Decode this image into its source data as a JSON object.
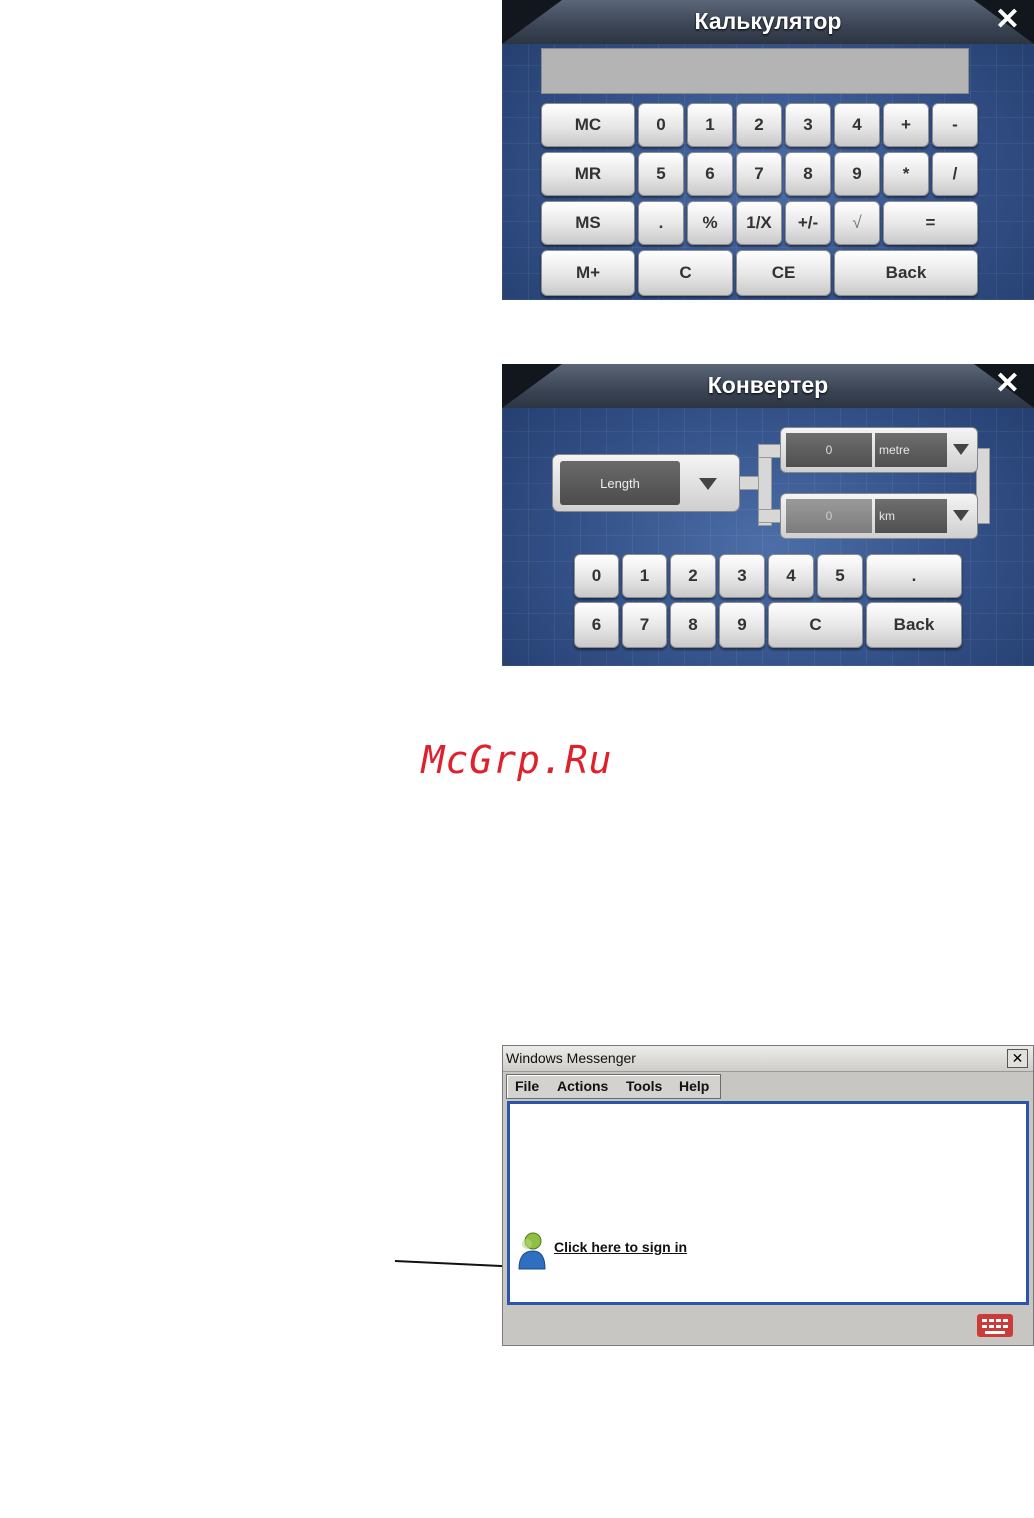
{
  "calculator": {
    "title": "Калькулятор",
    "close_glyph": "✕",
    "display_value": "",
    "keys": {
      "mc": "MC",
      "mr": "MR",
      "ms": "MS",
      "mplus": "M+",
      "d0": "0",
      "d1": "1",
      "d2": "2",
      "d3": "3",
      "d4": "4",
      "d5": "5",
      "d6": "6",
      "d7": "7",
      "d8": "8",
      "d9": "9",
      "plus": "+",
      "minus": "-",
      "multiply": "*",
      "divide": "/",
      "dot": ".",
      "percent": "%",
      "reciprocal": "1/X",
      "sign": "+/-",
      "sqrt": "√",
      "equals": "=",
      "clear": "C",
      "clear_entry": "CE",
      "back": "Back"
    }
  },
  "converter": {
    "title": "Конвертер",
    "close_glyph": "✕",
    "category": "Length",
    "from_value": "0",
    "from_unit": "metre",
    "to_value": "0",
    "to_unit": "km",
    "keys": {
      "d0": "0",
      "d1": "1",
      "d2": "2",
      "d3": "3",
      "d4": "4",
      "d5": "5",
      "d6": "6",
      "d7": "7",
      "d8": "8",
      "d9": "9",
      "dot": ".",
      "clear": "C",
      "back": "Back"
    }
  },
  "watermark": "McGrp.Ru",
  "messenger": {
    "title": "Windows Messenger",
    "close_glyph": "✕",
    "menu": {
      "file": "File",
      "actions": "Actions",
      "tools": "Tools",
      "help": "Help"
    },
    "signin_link": "Click here to sign in"
  },
  "colors": {
    "panel_blue": "#324f86",
    "watermark_red": "#e0202a",
    "messenger_border_blue": "#2a56a8",
    "keyboard_icon_red": "#cc3a3a"
  },
  "icons": {
    "close": "close-icon",
    "dropdown": "chevron-down-icon",
    "avatar": "user-icon",
    "keyboard": "keyboard-icon"
  }
}
